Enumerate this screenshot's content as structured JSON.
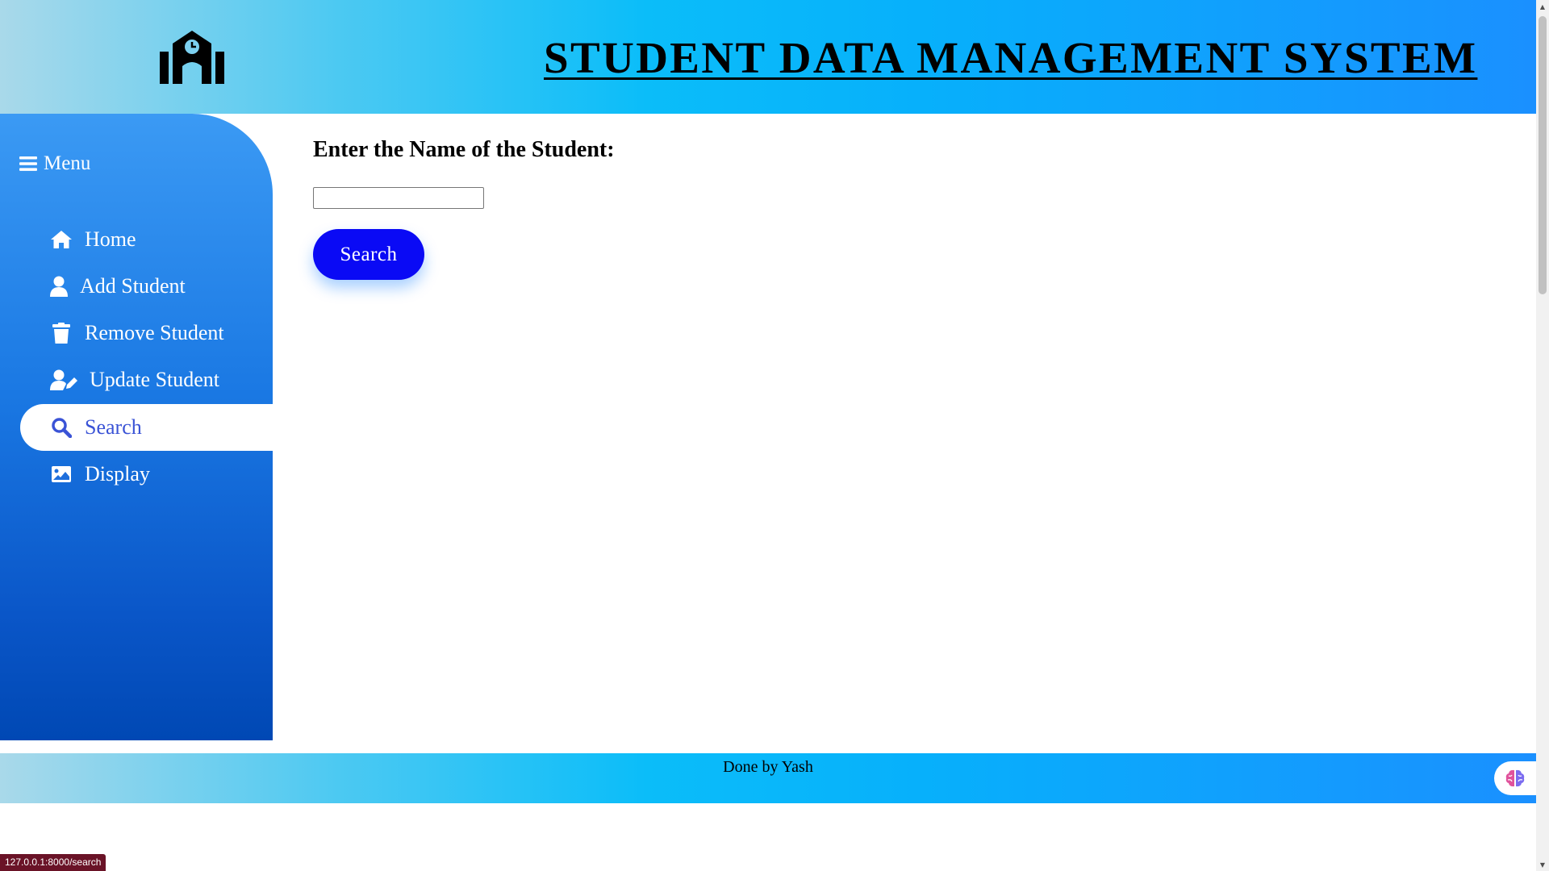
{
  "header": {
    "title": "STUDENT DATA MANAGEMENT SYSTEM",
    "logo_icon": "school-icon"
  },
  "sidebar": {
    "menu_label": "Menu",
    "menu_icon": "hamburger-icon",
    "items": [
      {
        "label": "Home",
        "icon": "home-icon",
        "active": false
      },
      {
        "label": "Add Student",
        "icon": "user-icon",
        "active": false
      },
      {
        "label": "Remove Student",
        "icon": "trash-icon",
        "active": false
      },
      {
        "label": "Update Student",
        "icon": "user-edit-icon",
        "active": false
      },
      {
        "label": "Search",
        "icon": "search-icon",
        "active": true
      },
      {
        "label": "Display",
        "icon": "image-icon",
        "active": false
      }
    ]
  },
  "main": {
    "heading": "Enter the Name of the Student:",
    "name_input_value": "",
    "search_button_label": "Search"
  },
  "footer": {
    "text": "Done by Yash",
    "extension_icon": "brain-icon"
  },
  "status_bar": {
    "url": "127.0.0.1:8000/search"
  },
  "colors": {
    "sidebar_active_text": "#3a53d6",
    "button_bg": "#0a0af5",
    "header_gradient_start": "#a9d9ea",
    "header_gradient_end": "#1a90ff"
  }
}
